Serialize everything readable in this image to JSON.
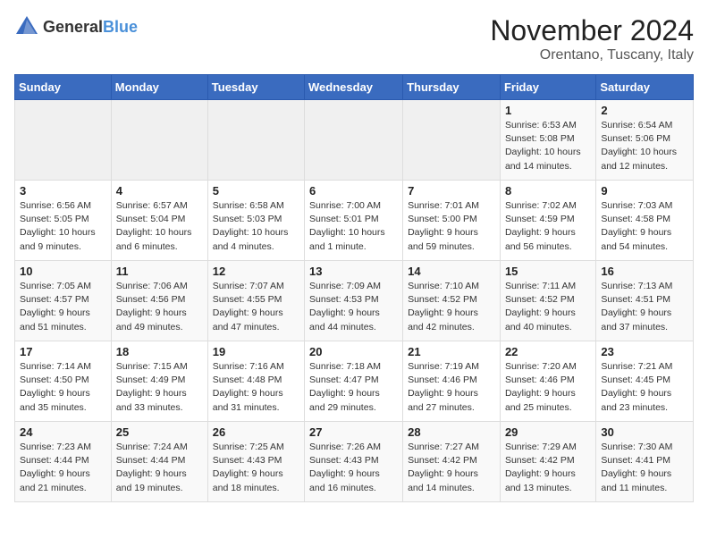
{
  "header": {
    "logo": {
      "general": "General",
      "blue": "Blue"
    },
    "title": "November 2024",
    "location": "Orentano, Tuscany, Italy"
  },
  "weekdays": [
    "Sunday",
    "Monday",
    "Tuesday",
    "Wednesday",
    "Thursday",
    "Friday",
    "Saturday"
  ],
  "weeks": [
    [
      {
        "day": "",
        "empty": true
      },
      {
        "day": "",
        "empty": true
      },
      {
        "day": "",
        "empty": true
      },
      {
        "day": "",
        "empty": true
      },
      {
        "day": "",
        "empty": true
      },
      {
        "day": "1",
        "info": "Sunrise: 6:53 AM\nSunset: 5:08 PM\nDaylight: 10 hours and 14 minutes."
      },
      {
        "day": "2",
        "info": "Sunrise: 6:54 AM\nSunset: 5:06 PM\nDaylight: 10 hours and 12 minutes."
      }
    ],
    [
      {
        "day": "3",
        "info": "Sunrise: 6:56 AM\nSunset: 5:05 PM\nDaylight: 10 hours and 9 minutes."
      },
      {
        "day": "4",
        "info": "Sunrise: 6:57 AM\nSunset: 5:04 PM\nDaylight: 10 hours and 6 minutes."
      },
      {
        "day": "5",
        "info": "Sunrise: 6:58 AM\nSunset: 5:03 PM\nDaylight: 10 hours and 4 minutes."
      },
      {
        "day": "6",
        "info": "Sunrise: 7:00 AM\nSunset: 5:01 PM\nDaylight: 10 hours and 1 minute."
      },
      {
        "day": "7",
        "info": "Sunrise: 7:01 AM\nSunset: 5:00 PM\nDaylight: 9 hours and 59 minutes."
      },
      {
        "day": "8",
        "info": "Sunrise: 7:02 AM\nSunset: 4:59 PM\nDaylight: 9 hours and 56 minutes."
      },
      {
        "day": "9",
        "info": "Sunrise: 7:03 AM\nSunset: 4:58 PM\nDaylight: 9 hours and 54 minutes."
      }
    ],
    [
      {
        "day": "10",
        "info": "Sunrise: 7:05 AM\nSunset: 4:57 PM\nDaylight: 9 hours and 51 minutes."
      },
      {
        "day": "11",
        "info": "Sunrise: 7:06 AM\nSunset: 4:56 PM\nDaylight: 9 hours and 49 minutes."
      },
      {
        "day": "12",
        "info": "Sunrise: 7:07 AM\nSunset: 4:55 PM\nDaylight: 9 hours and 47 minutes."
      },
      {
        "day": "13",
        "info": "Sunrise: 7:09 AM\nSunset: 4:53 PM\nDaylight: 9 hours and 44 minutes."
      },
      {
        "day": "14",
        "info": "Sunrise: 7:10 AM\nSunset: 4:52 PM\nDaylight: 9 hours and 42 minutes."
      },
      {
        "day": "15",
        "info": "Sunrise: 7:11 AM\nSunset: 4:52 PM\nDaylight: 9 hours and 40 minutes."
      },
      {
        "day": "16",
        "info": "Sunrise: 7:13 AM\nSunset: 4:51 PM\nDaylight: 9 hours and 37 minutes."
      }
    ],
    [
      {
        "day": "17",
        "info": "Sunrise: 7:14 AM\nSunset: 4:50 PM\nDaylight: 9 hours and 35 minutes."
      },
      {
        "day": "18",
        "info": "Sunrise: 7:15 AM\nSunset: 4:49 PM\nDaylight: 9 hours and 33 minutes."
      },
      {
        "day": "19",
        "info": "Sunrise: 7:16 AM\nSunset: 4:48 PM\nDaylight: 9 hours and 31 minutes."
      },
      {
        "day": "20",
        "info": "Sunrise: 7:18 AM\nSunset: 4:47 PM\nDaylight: 9 hours and 29 minutes."
      },
      {
        "day": "21",
        "info": "Sunrise: 7:19 AM\nSunset: 4:46 PM\nDaylight: 9 hours and 27 minutes."
      },
      {
        "day": "22",
        "info": "Sunrise: 7:20 AM\nSunset: 4:46 PM\nDaylight: 9 hours and 25 minutes."
      },
      {
        "day": "23",
        "info": "Sunrise: 7:21 AM\nSunset: 4:45 PM\nDaylight: 9 hours and 23 minutes."
      }
    ],
    [
      {
        "day": "24",
        "info": "Sunrise: 7:23 AM\nSunset: 4:44 PM\nDaylight: 9 hours and 21 minutes."
      },
      {
        "day": "25",
        "info": "Sunrise: 7:24 AM\nSunset: 4:44 PM\nDaylight: 9 hours and 19 minutes."
      },
      {
        "day": "26",
        "info": "Sunrise: 7:25 AM\nSunset: 4:43 PM\nDaylight: 9 hours and 18 minutes."
      },
      {
        "day": "27",
        "info": "Sunrise: 7:26 AM\nSunset: 4:43 PM\nDaylight: 9 hours and 16 minutes."
      },
      {
        "day": "28",
        "info": "Sunrise: 7:27 AM\nSunset: 4:42 PM\nDaylight: 9 hours and 14 minutes."
      },
      {
        "day": "29",
        "info": "Sunrise: 7:29 AM\nSunset: 4:42 PM\nDaylight: 9 hours and 13 minutes."
      },
      {
        "day": "30",
        "info": "Sunrise: 7:30 AM\nSunset: 4:41 PM\nDaylight: 9 hours and 11 minutes."
      }
    ]
  ]
}
